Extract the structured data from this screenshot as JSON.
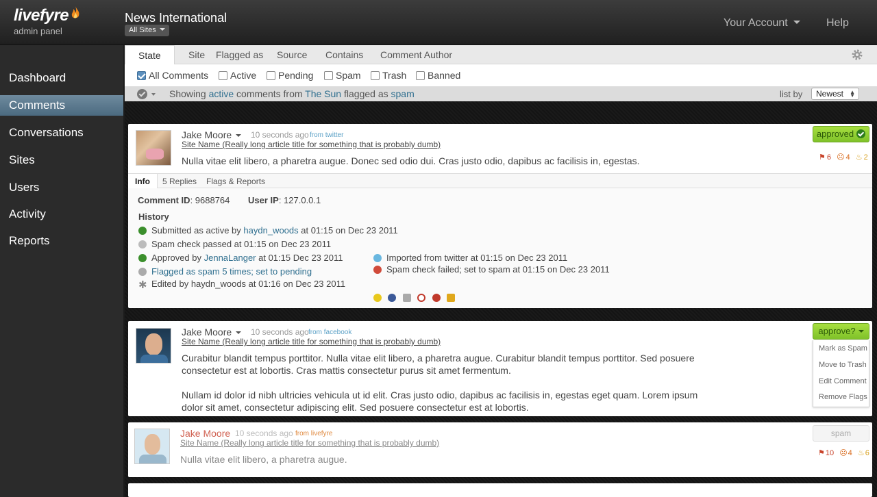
{
  "logo": {
    "word": "livefyre",
    "sub": "admin panel"
  },
  "header": {
    "title": "News International",
    "sites": "All Sites",
    "account": "Your Account",
    "help": "Help"
  },
  "sidebar": {
    "items": [
      "Dashboard",
      "Comments",
      "Conversations",
      "Sites",
      "Users",
      "Activity",
      "Reports"
    ],
    "active": "Comments"
  },
  "filter": {
    "tabs": [
      "State",
      "Site",
      "Flagged as",
      "Source",
      "Contains",
      "Comment Author"
    ],
    "checks": [
      {
        "label": "All Comments",
        "checked": true
      },
      {
        "label": "Active",
        "checked": false
      },
      {
        "label": "Pending",
        "checked": false
      },
      {
        "label": "Spam",
        "checked": false
      },
      {
        "label": "Trash",
        "checked": false
      },
      {
        "label": "Banned",
        "checked": false
      }
    ],
    "status": {
      "pre": "Showing ",
      "state": "active",
      "mid": " comments from ",
      "site": "The Sun",
      "mid2": " flagged as ",
      "flag": "spam"
    },
    "list_by": "list by",
    "sort": "Newest"
  },
  "comments": [
    {
      "author": "Jake Moore",
      "time": "10 seconds ago",
      "source": "from twitter",
      "article": "Site Name (Really long article title for something that is probably dumb)",
      "body": "Nulla vitae elit libero, a pharetra augue. Donec sed odio dui. Cras justo odio, dapibus ac facilisis in, egestas.",
      "status": "approved",
      "flags": {
        "red": "6",
        "orange": "4",
        "gold": "2"
      },
      "tabs": [
        "Info",
        "5 Replies",
        "Flags & Reports"
      ],
      "comment_id_label": "Comment ID",
      "comment_id": ": 9688764",
      "user_ip_label": "User IP",
      "user_ip": ": 127.0.0.1",
      "history_title": "History",
      "history": {
        "submitted_pre": "Submitted as active by ",
        "submitted_user": "haydn_woods",
        "submitted_post": " at 01:15 on Dec 23 2011",
        "spam_pass": "Spam check passed at 01:15 on Dec 23 2011",
        "approved_pre": "Approved by ",
        "approved_user": "JennaLanger",
        "approved_post": " at 01:15 Dec 23 2011",
        "flagged": "Flagged as spam 5 times; set to pending",
        "edited": "Edited by haydn_woods at 01:16 on Dec 23 2011",
        "imported": "Imported from twitter at 01:15 on Dec 23 2011",
        "spam_fail": "Spam check failed; set to spam at 01:15 on Dec 23 2011"
      }
    },
    {
      "author": "Jake Moore",
      "time": "10 seconds ago",
      "source": "from facebook",
      "article": "Site Name (Really long article title for something that is probably dumb)",
      "body1": "Curabitur blandit tempus porttitor. Nulla vitae elit libero, a pharetra augue. Curabitur blandit tempus porttitor. Sed posuere consectetur est at lobortis. Cras mattis consectetur purus sit amet fermentum.",
      "body2": "Nullam id dolor id nibh ultricies vehicula ut id elit. Cras justo odio, dapibus ac facilisis in, egestas eget quam. Lorem ipsum dolor sit amet, consectetur adipiscing elit. Sed posuere consectetur est at lobortis.",
      "status": "approve?",
      "menu": [
        "Mark as Spam",
        "Move to Trash",
        "Edit Comment",
        "Remove Flags"
      ]
    },
    {
      "author": "Jake Moore",
      "time": "10 seconds ago",
      "source": "from livefyre",
      "article": "Site Name (Really long article title for something that is probably dumb)",
      "body": "Nulla vitae elit libero, a pharetra augue.",
      "status": "spam",
      "flags": {
        "red": "10",
        "orange": "4",
        "gold": "6"
      }
    }
  ]
}
